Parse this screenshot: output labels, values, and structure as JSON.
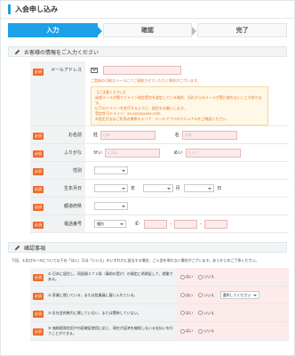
{
  "title": "入会申し込み",
  "steps": [
    {
      "label": "入力"
    },
    {
      "label": "確認"
    },
    {
      "label": "完了"
    }
  ],
  "customer_section": {
    "heading": "お客様の情報をご入力ください"
  },
  "required_badge": "必須",
  "email": {
    "label": "メールアドレス",
    "note": "ご登録の可能なメールにてご連絡させていただく場合がございます。",
    "warning_lines": [
      "【ご注意ください】",
      "迷惑メール対策でドメイン指定受信を設定している場合、当社からのメールが受け取れないことがあります。",
      "以下のドメインを許可するように、設定をお願いします。",
      "受信許可ドメイン：xn-xxxxxxxxx.com",
      "※設定方法はご利用の携帯キャリア・メールアプリのマニュアルをご確認ください。"
    ]
  },
  "name": {
    "label": "お名前",
    "sei_label": "姓",
    "mei_label": "名",
    "sei_placeholder": "日本",
    "mei_placeholder": "太郎"
  },
  "kana": {
    "label": "ふりがな",
    "sei_label": "せい",
    "mei_label": "めい",
    "sei_placeholder": "にほん",
    "mei_placeholder": "たろう"
  },
  "gender": {
    "label": "性別"
  },
  "birthday": {
    "label": "生年月日",
    "year_suffix": "年",
    "month_suffix": "月",
    "day_suffix": "日"
  },
  "prefecture": {
    "label": "都道府県"
  },
  "phone": {
    "label": "電話番号",
    "type_value": "種別"
  },
  "confirm_section": {
    "heading": "確認事項",
    "intro": "下記、①及び②～④について以下の「はい」又は「いいえ」のいずれかに該当する場合、ご入会を承れない場合がございます。あらかじめご了承ください。"
  },
  "questions": [
    {
      "text": "① 日本に居住し、同居親２７２条（事前の受け）の規定に承締証して、就業である。"
    },
    {
      "text": "② 家業に就いている、または従業員に雇い入れている。",
      "select": "選択してください"
    },
    {
      "text": "③ 反社会的勢力に属していない、または関係していない。"
    },
    {
      "text": "④ 価格経過信用や内容確証使用に応じ、現在が返済を継続しないる支払いを行うことができる。"
    }
  ],
  "answers": {
    "yes": "はい",
    "no": "いいえ"
  }
}
